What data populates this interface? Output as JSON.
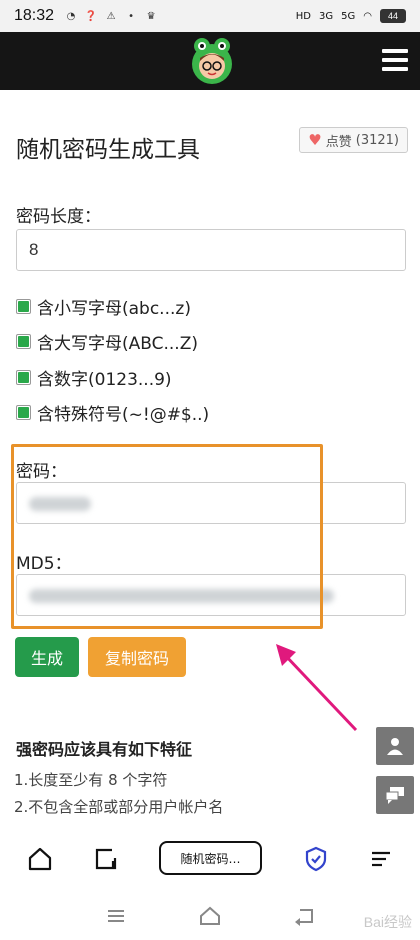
{
  "status_bar": {
    "time": "18:32",
    "network_labels": [
      "HD",
      "3G",
      "5G"
    ],
    "battery": "44"
  },
  "header": {
    "logo_icon": "frog-mascot-logo",
    "menu_icon": "hamburger-menu-icon"
  },
  "page": {
    "title": "随机密码生成工具",
    "like_label": "点赞",
    "like_count": "(3121)"
  },
  "length": {
    "label": "密码长度：",
    "value": "8"
  },
  "options": [
    {
      "label": "含小写字母(abc...z)",
      "checked": true
    },
    {
      "label": "含大写字母(ABC...Z)",
      "checked": true
    },
    {
      "label": "含数字(0123...9)",
      "checked": true
    },
    {
      "label": "含特殊符号(~!@#$..)",
      "checked": true
    }
  ],
  "password": {
    "label": "密码："
  },
  "md5": {
    "label": "MD5："
  },
  "buttons": {
    "generate": "生成",
    "copy": "复制密码"
  },
  "tips": {
    "title": "强密码应该具有如下特征",
    "items": [
      "1.长度至少有 8 个字符",
      "2.不包含全部或部分用户帐户名"
    ]
  },
  "browser_bar": {
    "tab_label": "随机密码…"
  },
  "watermark": "Bai经验",
  "colors": {
    "header_bg": "#151515",
    "green": "#259b4b",
    "orange": "#f0a133",
    "highlight": "#e8922a",
    "arrow": "#e0197d"
  }
}
